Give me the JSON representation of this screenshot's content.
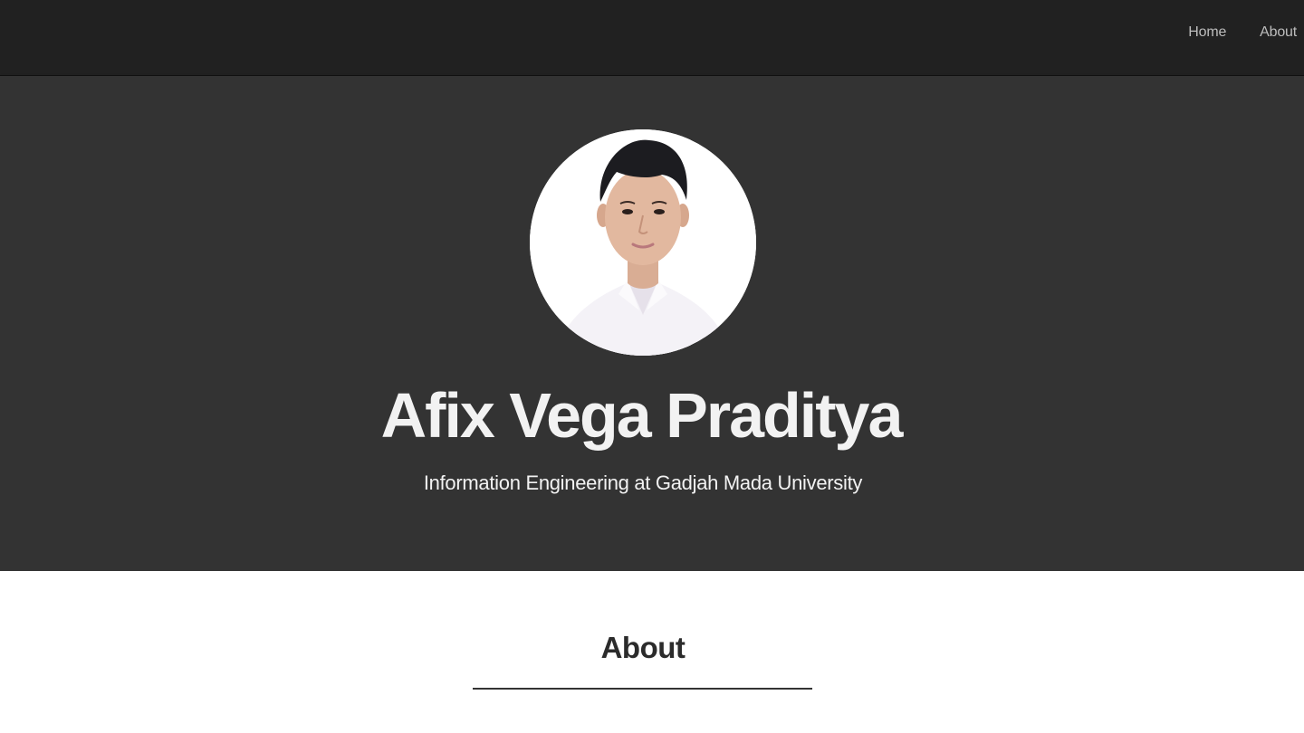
{
  "nav": {
    "items": [
      {
        "label": "Home"
      },
      {
        "label": "About"
      }
    ]
  },
  "hero": {
    "name": "Afix Vega Praditya",
    "subtitle": "Information Engineering at Gadjah Mada University",
    "avatar_icon": "profile-photo"
  },
  "about": {
    "heading": "About"
  },
  "colors": {
    "navbar_bg": "#212121",
    "hero_bg": "#333333",
    "text_light": "#f2f2f2",
    "nav_text": "#bdbdbd",
    "page_bg": "#ffffff"
  }
}
